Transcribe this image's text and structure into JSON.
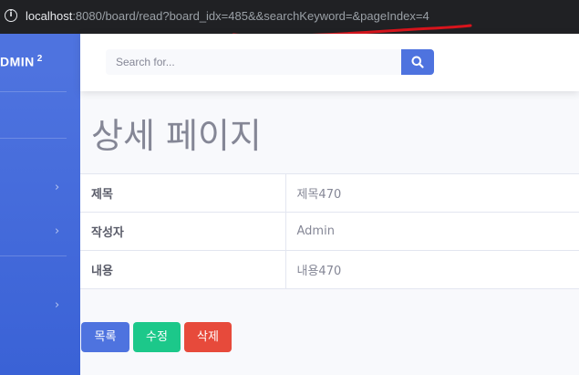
{
  "browser": {
    "url_host": "localhost",
    "url_rest": ":8080/board/read?board_idx=485&&searchKeyword=&pageIndex=4"
  },
  "sidebar": {
    "brand": "DMIN",
    "brand_sup": "2",
    "items": [
      {
        "icon": "chevron-right-icon"
      },
      {
        "icon": "chevron-right-icon"
      },
      {
        "icon": "chevron-right-icon"
      }
    ]
  },
  "topbar": {
    "search_placeholder": "Search for...",
    "search_icon": "search-icon"
  },
  "page": {
    "title": "상세 페이지"
  },
  "detail": {
    "rows": [
      {
        "label": "제목",
        "value": "제목470"
      },
      {
        "label": "작성자",
        "value": "Admin"
      },
      {
        "label": "내용",
        "value": "내용470"
      }
    ]
  },
  "buttons": {
    "list": "목록",
    "edit": "수정",
    "delete": "삭제"
  },
  "colors": {
    "primary": "#4e73df",
    "success": "#1cc88a",
    "danger": "#e74a3b",
    "annotation": "#d8141c"
  }
}
